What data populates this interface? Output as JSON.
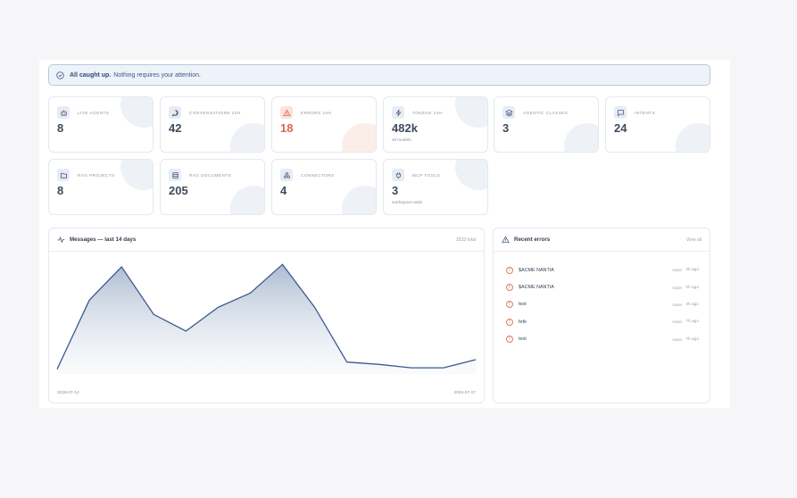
{
  "banner": {
    "strong": "All caught up.",
    "text": "Nothing requires your attention."
  },
  "stats": [
    {
      "label": "Live agents",
      "value": "8",
      "sub": "",
      "icon": "robot-icon"
    },
    {
      "label": "Conversations 24h",
      "value": "42",
      "sub": "",
      "icon": "chat-bubble-icon"
    },
    {
      "label": "Errors 24h",
      "value": "18",
      "sub": "",
      "icon": "warning-triangle-icon"
    },
    {
      "label": "Tokens 24h",
      "value": "482k",
      "sub": "all models",
      "icon": "bolt-icon"
    },
    {
      "label": "Agentic classes",
      "value": "3",
      "sub": "",
      "icon": "layers-icon"
    },
    {
      "label": "Intents",
      "value": "24",
      "sub": "",
      "icon": "message-square-icon"
    },
    {
      "label": "RAG projects",
      "value": "8",
      "sub": "",
      "icon": "folder-icon"
    },
    {
      "label": "RAG documents",
      "value": "205",
      "sub": "",
      "icon": "database-icon"
    },
    {
      "label": "Connectors",
      "value": "4",
      "sub": "",
      "icon": "network-icon"
    },
    {
      "label": "MCP tools",
      "value": "3",
      "sub": "workspace-wide",
      "icon": "plug-icon"
    }
  ],
  "messages_panel": {
    "title": "Messages — last 14 days",
    "total": "2533 total",
    "start_date": "2026-07-14",
    "end_date": "2026-07-27"
  },
  "chart_data": {
    "type": "area",
    "title": "Messages — last 14 days",
    "x": [
      "2026-07-14",
      "2026-07-15",
      "2026-07-16",
      "2026-07-17",
      "2026-07-18",
      "2026-07-19",
      "2026-07-20",
      "2026-07-21",
      "2026-07-22",
      "2026-07-23",
      "2026-07-24",
      "2026-07-25",
      "2026-07-26",
      "2026-07-27"
    ],
    "values": [
      10,
      155,
      225,
      125,
      90,
      140,
      170,
      230,
      140,
      25,
      20,
      13,
      13,
      30
    ],
    "ylim": [
      0,
      240
    ],
    "color": "#3d5a8f"
  },
  "errors_panel": {
    "title": "Recent errors",
    "view_all": "View all",
    "items": [
      {
        "name": "$ACME NANTIA",
        "source": "router",
        "time": "2h ago"
      },
      {
        "name": "$ACME NANTIA",
        "source": "router",
        "time": "2h ago"
      },
      {
        "name": "test",
        "source": "router",
        "time": "3h ago"
      },
      {
        "name": "fefe",
        "source": "router",
        "time": "7h ago"
      },
      {
        "name": "test",
        "source": "router",
        "time": "7h ago"
      }
    ]
  }
}
